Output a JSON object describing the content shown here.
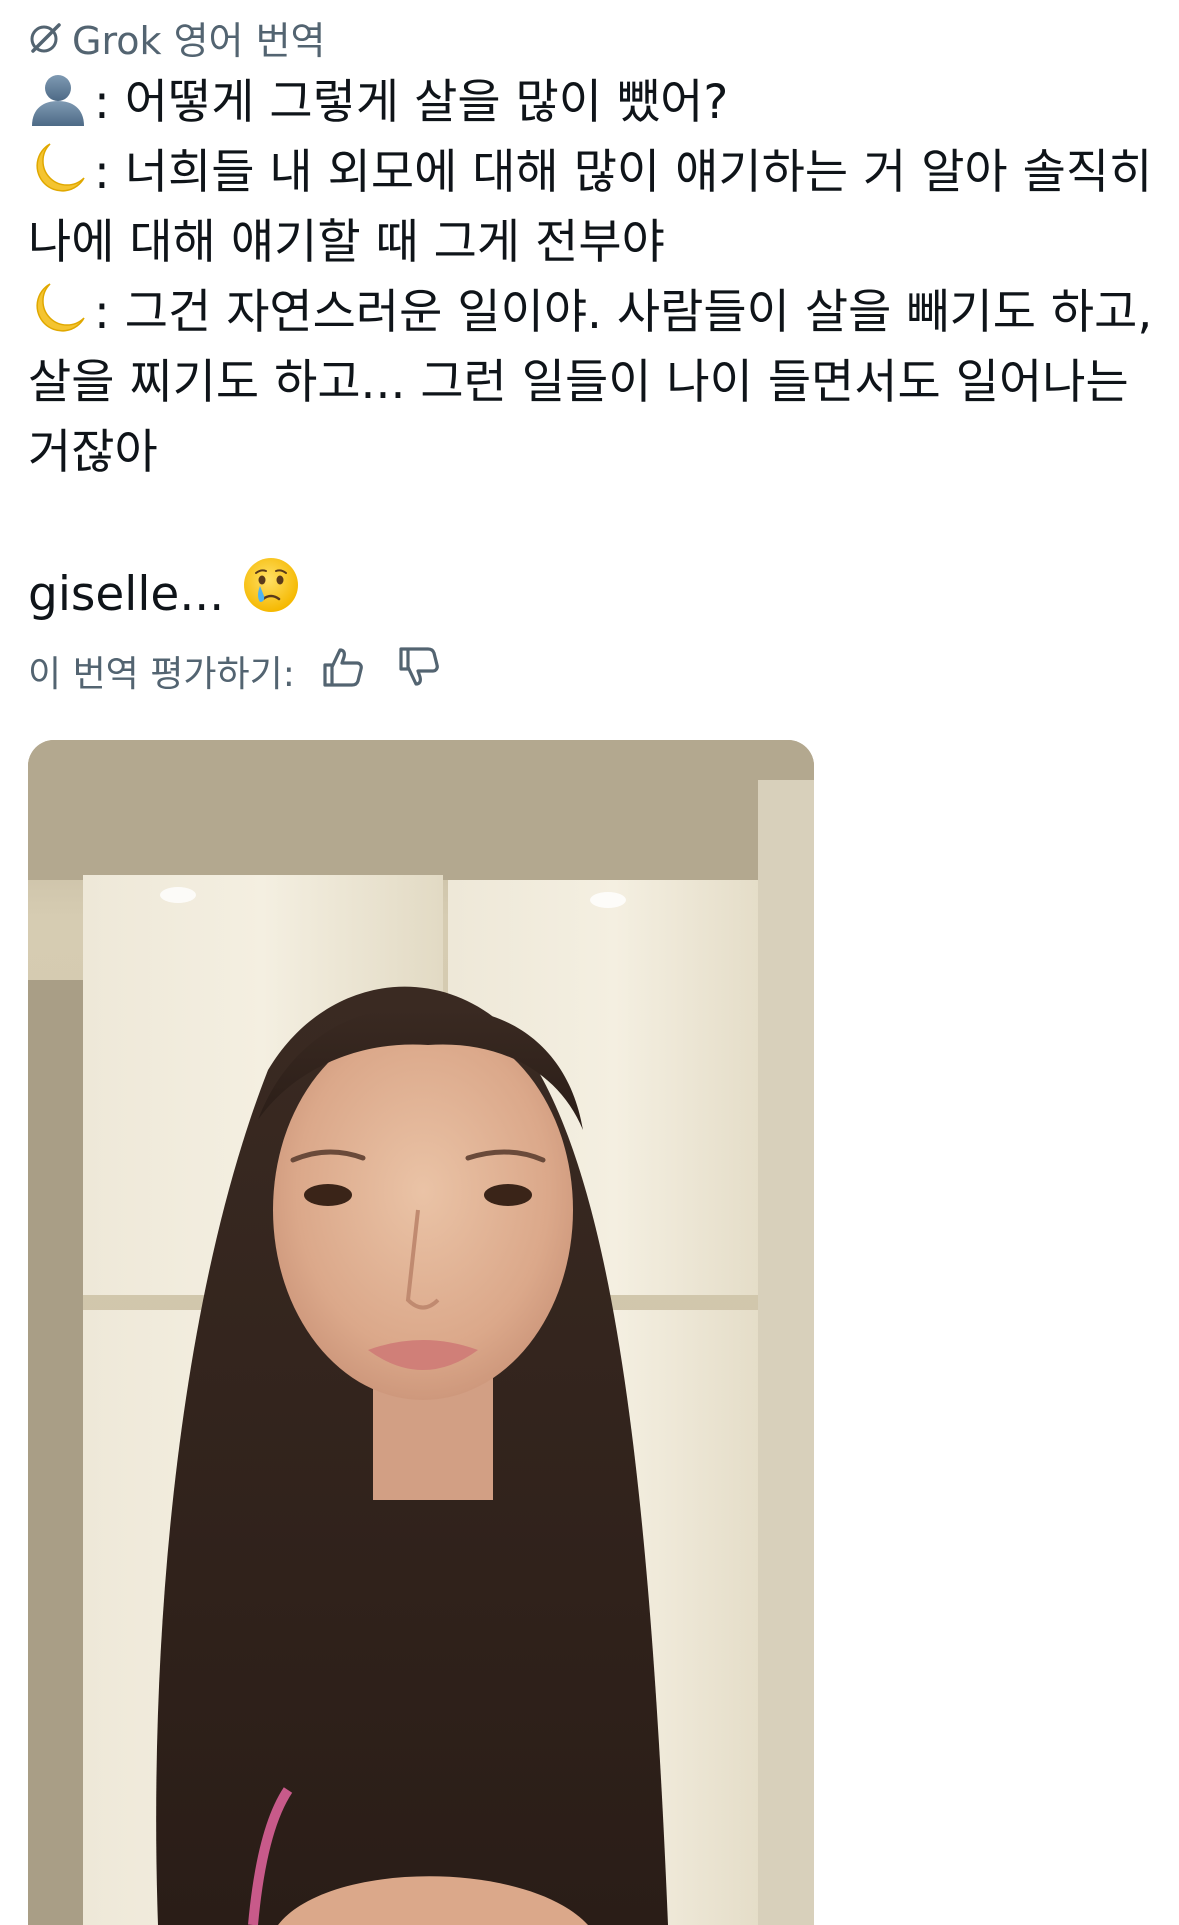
{
  "translation": {
    "label": "Grok 영어 번역"
  },
  "post": {
    "lines": [
      {
        "speaker": "person",
        "text": ": 어떻게 그렇게 살을 많이 뺐어?"
      },
      {
        "speaker": "moon",
        "text": ": 너희들 내 외모에 대해 많이 얘기하는 거 알아 솔직히"
      },
      {
        "speaker": "",
        "text": "나에 대해 얘기할 때 그게 전부야"
      },
      {
        "speaker": "moon",
        "text": ": 그건 자연스러운 일이야. 사람들이 살을 빼기도 하고,"
      },
      {
        "speaker": "",
        "text": "살을 찌기도 하고... 그런 일들이 나이 들면서도 일어나는"
      },
      {
        "speaker": "",
        "text": "거잖아"
      }
    ],
    "signature": "giselle...",
    "signature_emoji": "crying-face"
  },
  "rating": {
    "label": "이 번역 평가하기:",
    "up_icon": "thumbs-up-icon",
    "down_icon": "thumbs-down-icon"
  },
  "media": {
    "type": "video-thumbnail"
  },
  "colors": {
    "text": "#0f1419",
    "secondary": "#536471",
    "background": "#ffffff"
  }
}
